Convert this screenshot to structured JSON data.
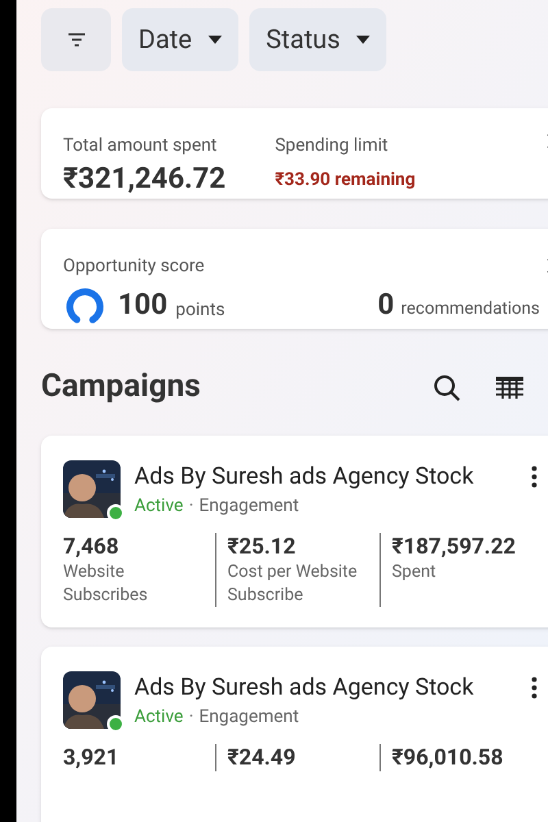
{
  "filters": [
    {
      "label": "Date"
    },
    {
      "label": "Status"
    }
  ],
  "spend_card": {
    "total_label": "Total amount spent",
    "total_value": "₹321,246.72",
    "limit_label": "Spending limit",
    "limit_value": "₹33.90 remaining"
  },
  "opportunity_card": {
    "label": "Opportunity score",
    "score": "100",
    "score_unit": "points",
    "recommendations": "0",
    "recommendations_unit": "recommendations"
  },
  "campaigns": {
    "title": "Campaigns",
    "items": [
      {
        "name": "Ads By Suresh ads Agency Stock",
        "active": true,
        "status": "Active",
        "separator": "·",
        "objective": "Engagement",
        "metrics": [
          {
            "value": "7,468",
            "label": "Website Subscribes"
          },
          {
            "value": "₹25.12",
            "label": "Cost per Website Subscribe"
          },
          {
            "value": "₹187,597.22",
            "label": "Spent"
          }
        ]
      },
      {
        "name": "Ads By Suresh ads Agency Stock",
        "active": true,
        "status": "Active",
        "separator": "·",
        "objective": "Engagement",
        "metrics": [
          {
            "value": "3,921"
          },
          {
            "value": "₹24.49"
          },
          {
            "value": "₹96,010.58"
          }
        ]
      }
    ]
  }
}
